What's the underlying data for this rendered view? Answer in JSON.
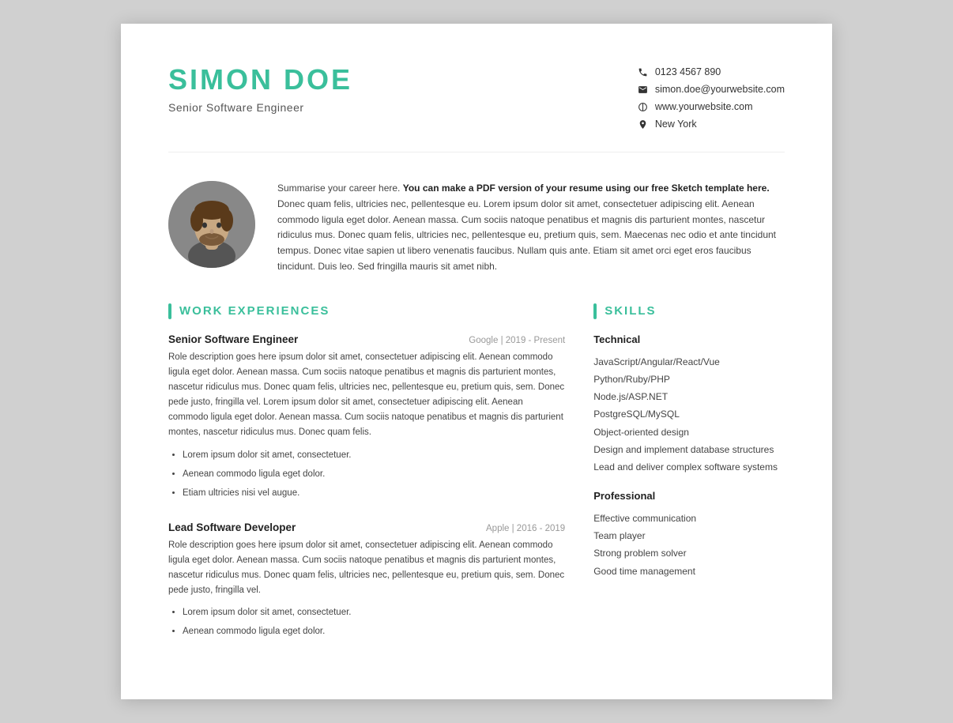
{
  "header": {
    "name": "SIMON DOE",
    "job_title": "Senior Software Engineer",
    "contact": {
      "phone": "0123 4567 890",
      "email": "simon.doe@yourwebsite.com",
      "website": "www.yourwebsite.com",
      "location": "New York"
    }
  },
  "bio": {
    "intro": "Summarise your career here. ",
    "bold_part": "You can make a PDF version of your resume using our free Sketch template here.",
    "rest": " Donec quam felis, ultricies nec, pellentesque eu. Lorem ipsum dolor sit amet, consectetuer adipiscing elit. Aenean commodo ligula eget dolor. Aenean massa. Cum sociis natoque penatibus et magnis dis parturient montes, nascetur ridiculus mus. Donec quam felis, ultricies nec, pellentesque eu, pretium quis, sem. Maecenas nec odio et ante tincidunt tempus. Donec vitae sapien ut libero venenatis faucibus. Nullam quis ante. Etiam sit amet orci eget eros faucibus tincidunt. Duis leo. Sed fringilla mauris sit amet nibh."
  },
  "sections": {
    "work_experiences_label": "WORK EXPERIENCES",
    "skills_label": "SKILLS"
  },
  "work_experiences": [
    {
      "title": "Senior Software Engineer",
      "company": "Google | 2019 - Present",
      "description": "Role description goes here ipsum dolor sit amet, consectetuer adipiscing elit. Aenean commodo ligula eget dolor. Aenean massa. Cum sociis natoque penatibus et magnis dis parturient montes, nascetur ridiculus mus. Donec quam felis, ultricies nec, pellentesque eu, pretium quis, sem. Donec pede justo, fringilla vel. Lorem ipsum dolor sit amet, consectetuer adipiscing elit. Aenean commodo ligula eget dolor. Aenean massa. Cum sociis natoque penatibus et magnis dis parturient montes, nascetur ridiculus mus. Donec quam felis.",
      "bullets": [
        "Lorem ipsum dolor sit amet, consectetuer.",
        "Aenean commodo ligula eget dolor.",
        "Etiam ultricies nisi vel augue."
      ]
    },
    {
      "title": "Lead Software Developer",
      "company": "Apple | 2016 - 2019",
      "description": "Role description goes here ipsum dolor sit amet, consectetuer adipiscing elit. Aenean commodo ligula eget dolor. Aenean massa. Cum sociis natoque penatibus et magnis dis parturient montes, nascetur ridiculus mus. Donec quam felis, ultricies nec, pellentesque eu, pretium quis, sem. Donec pede justo, fringilla vel.",
      "bullets": [
        "Lorem ipsum dolor sit amet, consectetuer.",
        "Aenean commodo ligula eget dolor."
      ]
    }
  ],
  "skills": {
    "technical_label": "Technical",
    "technical_items": [
      "JavaScript/Angular/React/Vue",
      "Python/Ruby/PHP",
      "Node.js/ASP.NET",
      "PostgreSQL/MySQL",
      "Object-oriented design",
      "Design and implement database structures",
      "Lead and deliver complex software systems"
    ],
    "professional_label": "Professional",
    "professional_items": [
      "Effective communication",
      "Team player",
      "Strong problem solver",
      "Good time management"
    ]
  }
}
